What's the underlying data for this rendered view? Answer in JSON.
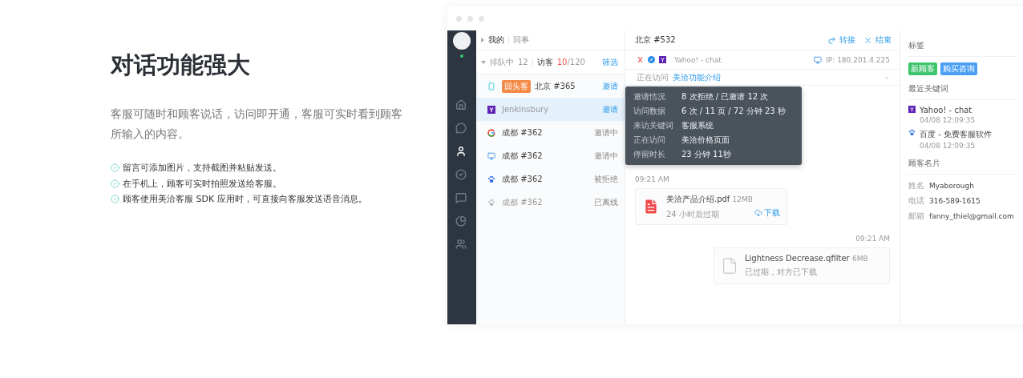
{
  "hero": {
    "title": "对话功能强大",
    "description": "客服可随时和顾客说话，访问即开通，客服可实时看到顾客所输入的内容。",
    "features": [
      "留言可添加图片，支持截图并粘贴发送。",
      "在手机上，顾客可实时拍照发送给客服。",
      "顾客使用美洽客服 SDK 应用时，可直接向客服发送语音消息。"
    ]
  },
  "app": {
    "nav": [
      {
        "kind": "home",
        "selected": false
      },
      {
        "kind": "chat",
        "selected": false
      },
      {
        "kind": "person",
        "selected": true
      },
      {
        "kind": "check",
        "selected": false
      },
      {
        "kind": "feedback",
        "selected": false
      },
      {
        "kind": "pie",
        "selected": false
      },
      {
        "kind": "team",
        "selected": false
      }
    ],
    "list_tabs": [
      {
        "label": "我的",
        "selected": true
      },
      {
        "label": "同事",
        "selected": false
      }
    ],
    "queue": {
      "label": "排队中",
      "count": "12",
      "visitors_label": "访客",
      "visitors_now": "10",
      "visitors_max": "/120",
      "filter": "筛选"
    },
    "visitors": [
      {
        "kind": "phone",
        "badge": "回头客",
        "name": "北京 #365",
        "action": "邀请",
        "invite": true,
        "selected": false
      },
      {
        "kind": "yahoo",
        "name": "Jenkinsbury",
        "action": "邀请",
        "invite": true,
        "selected": true
      },
      {
        "kind": "google",
        "name": "成都 #362",
        "action": "邀请中",
        "invite": false,
        "selected": false
      },
      {
        "kind": "desktop",
        "name": "成都 #362",
        "action": "邀请中",
        "invite": false,
        "selected": false
      },
      {
        "kind": "baidu",
        "name": "成都 #362",
        "action": "被拒绝",
        "invite": false,
        "selected": false
      },
      {
        "kind": "baidu-offline",
        "name": "成都 #362",
        "action": "已离线",
        "invite": false,
        "selected": false
      }
    ],
    "chat": {
      "title": "北京 #532",
      "actions": [
        {
          "kind": "transfer",
          "label": "转接"
        },
        {
          "kind": "end",
          "label": "结束"
        }
      ],
      "source_text": "Yahoo! - chat",
      "ip": "IP: 180.201.4.225",
      "visiting_label": "正在访问",
      "visiting_page": "美洽功能介绍",
      "tooltip": [
        {
          "label": "邀请情况",
          "value": "8 次拒绝 / 已邀请 12 次"
        },
        {
          "label": "访问数据",
          "value": "6 次 / 11 页 / 72 分钟 23 秒"
        },
        {
          "label": "来访关键词",
          "value": "客服系统"
        },
        {
          "label": "正在访问",
          "value": "美洽价格页面"
        },
        {
          "label": "停留时长",
          "value": "23 分钟 11秒"
        }
      ],
      "messages": [
        {
          "outgoing": false,
          "time": "09:21 AM",
          "file": "美洽产品介绍.pdf",
          "size": "12MB",
          "note": "24 小时后过期",
          "kind": "pdf",
          "download": "下载"
        },
        {
          "outgoing": true,
          "time": "09:21 AM",
          "file": "Lightness Decrease.qfilter",
          "size": "6MB",
          "note": "已过期，对方已下载",
          "kind": "blank"
        }
      ]
    },
    "profile": {
      "tags_title": "标签",
      "tags": [
        {
          "label": "新顾客",
          "color": "#3ec46d"
        },
        {
          "label": "购买咨询",
          "color": "#4a9ff5"
        }
      ],
      "keywords_title": "最近关键词",
      "keywords": [
        {
          "kind": "yahoo",
          "text": "Yahoo! - chat",
          "time": "04/08 12:09:35"
        },
        {
          "kind": "baidu",
          "text": "百度 - 免费客服软件",
          "time": "04/08 12:09:35"
        }
      ],
      "card_title": "顾客名片",
      "fields": [
        {
          "label": "姓名",
          "value": "Myaborough"
        },
        {
          "label": "电话",
          "value": "316-589-1615"
        },
        {
          "label": "邮箱",
          "value": "fanny_thiel@gmail.com"
        }
      ]
    }
  }
}
